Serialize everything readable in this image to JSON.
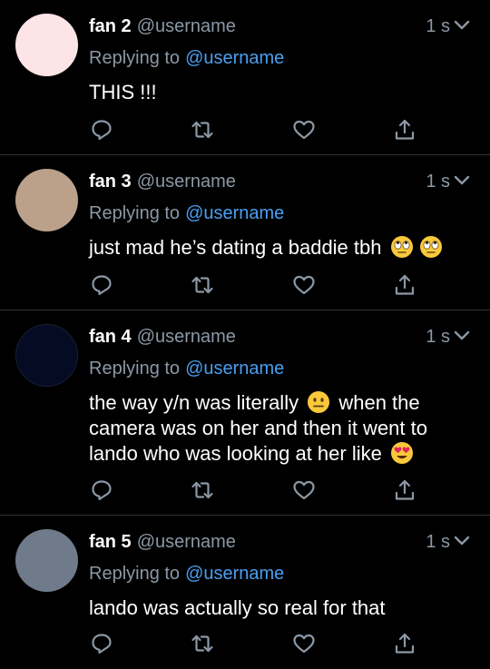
{
  "colors": {
    "background": "#000000",
    "divider": "#2f3336",
    "muted": "#8b98a5",
    "mention": "#4a9ff0",
    "text": "#ffffff"
  },
  "icons": [
    "reply-icon",
    "retweet-icon",
    "like-icon",
    "share-icon",
    "chevron-down-icon"
  ],
  "tweets": [
    {
      "name": "fan 2",
      "handle": "@username",
      "time": "1 s",
      "reply_label": "Replying to",
      "reply_to": "@username",
      "text": "THIS !!!",
      "avatar_color": "#fde4e6"
    },
    {
      "name": "fan 3",
      "handle": "@username",
      "time": "1 s",
      "reply_label": "Replying to",
      "reply_to": "@username",
      "text": "just mad he’s dating a baddie tbh",
      "emojis": [
        "face-with-rolling-eyes",
        "face-with-rolling-eyes"
      ],
      "avatar_color": "#bba08a"
    },
    {
      "name": "fan 4",
      "handle": "@username",
      "time": "1 s",
      "reply_label": "Replying to",
      "reply_to": "@username",
      "text_a": "the way y/n was literally",
      "text_b": "when the camera was on her and then it went to lando who was looking at her like",
      "emojis": [
        "neutral-face",
        "smiling-face-with-heart-eyes"
      ],
      "avatar_color": "#050b23"
    },
    {
      "name": "fan 5",
      "handle": "@username",
      "time": "1 s",
      "reply_label": "Replying to",
      "reply_to": "@username",
      "text": "lando was actually so real for that",
      "avatar_color": "#6f7b8a"
    }
  ]
}
